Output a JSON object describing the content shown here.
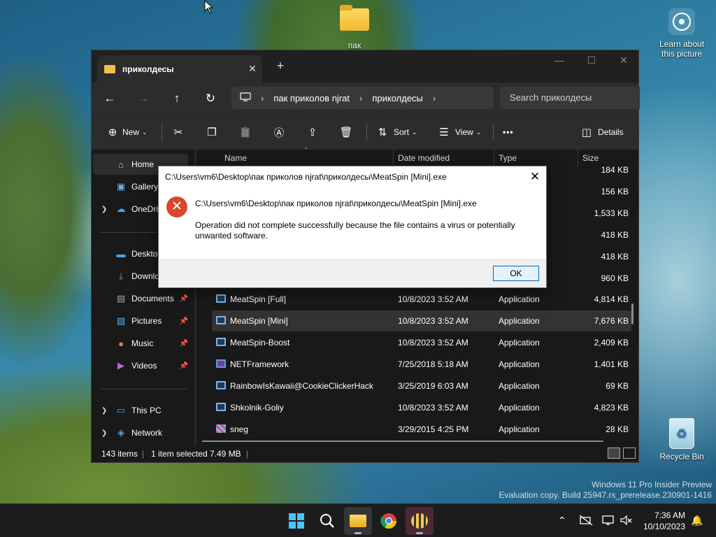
{
  "desktop": {
    "folder_icon_label": "пак",
    "learn_label": "Learn about\nthis picture",
    "recycle_label": "Recycle Bin",
    "watermark_line1": "Windows 11 Pro Insider Preview",
    "watermark_line2": "Evaluation copy. Build 25947.rs_prerelease.230901-1416"
  },
  "explorer": {
    "tab_title": "приколдесы",
    "tab_close": "✕",
    "tab_add": "+",
    "breadcrumb": [
      "пак приколов njrat",
      "приколдесы"
    ],
    "search_placeholder": "Search приколдесы",
    "toolbar": {
      "new_label": "New",
      "sort_label": "Sort",
      "view_label": "View",
      "more_label": "•••",
      "details_label": "Details"
    },
    "sidebar": [
      {
        "label": "Home",
        "icon": "home-icon"
      },
      {
        "label": "Gallery",
        "icon": "gallery-icon"
      },
      {
        "label": "OneDrive",
        "icon": "cloud-icon"
      },
      {
        "label": "Desktop",
        "icon": "desktop-icon"
      },
      {
        "label": "Downloads",
        "icon": "download-icon"
      },
      {
        "label": "Documents",
        "icon": "document-icon"
      },
      {
        "label": "Pictures",
        "icon": "picture-icon"
      },
      {
        "label": "Music",
        "icon": "music-icon"
      },
      {
        "label": "Videos",
        "icon": "video-icon"
      },
      {
        "label": "This PC",
        "icon": "pc-icon"
      },
      {
        "label": "Network",
        "icon": "network-icon"
      }
    ],
    "columns": [
      "Name",
      "Date modified",
      "Type",
      "Size"
    ],
    "hidden_sizes": [
      "184 KB",
      "156 KB",
      "1,533 KB",
      "418 KB",
      "418 KB",
      "960 KB"
    ],
    "files": [
      {
        "name": "MeatSpin [Full]",
        "date": "10/8/2023 3:52 AM",
        "type": "Application",
        "size": "4,814 KB"
      },
      {
        "name": "MeatSpin [Mini]",
        "date": "10/8/2023 3:52 AM",
        "type": "Application",
        "size": "7,676 KB"
      },
      {
        "name": "MeatSpin-Boost",
        "date": "10/8/2023 3:52 AM",
        "type": "Application",
        "size": "2,409 KB"
      },
      {
        "name": "NETFramework",
        "date": "7/25/2018 5:18 AM",
        "type": "Application",
        "size": "1,401 KB"
      },
      {
        "name": "RainbowIsKawaii@CookieClickerHack",
        "date": "3/25/2019 6:03 AM",
        "type": "Application",
        "size": "69 KB"
      },
      {
        "name": "Shkolnik-Goliy",
        "date": "10/8/2023 3:52 AM",
        "type": "Application",
        "size": "4,823 KB"
      },
      {
        "name": "sneg",
        "date": "3/29/2015 4:25 PM",
        "type": "Application",
        "size": "28 KB"
      }
    ],
    "status": {
      "count": "143 items",
      "selected": "1 item selected",
      "selected_size": "7.49 MB"
    }
  },
  "dialog": {
    "title": "C:\\Users\\vm6\\Desktop\\пак приколов njrat\\приколдесы\\MeatSpin [Mini].exe",
    "path": "C:\\Users\\vm6\\Desktop\\пак приколов njrat\\приколдесы\\MeatSpin [Mini].exe",
    "message": "Operation did not complete successfully because the file contains a virus or potentially unwanted software.",
    "ok_label": "OK"
  },
  "taskbar": {
    "time": "7:36 AM",
    "date": "10/10/2023"
  }
}
